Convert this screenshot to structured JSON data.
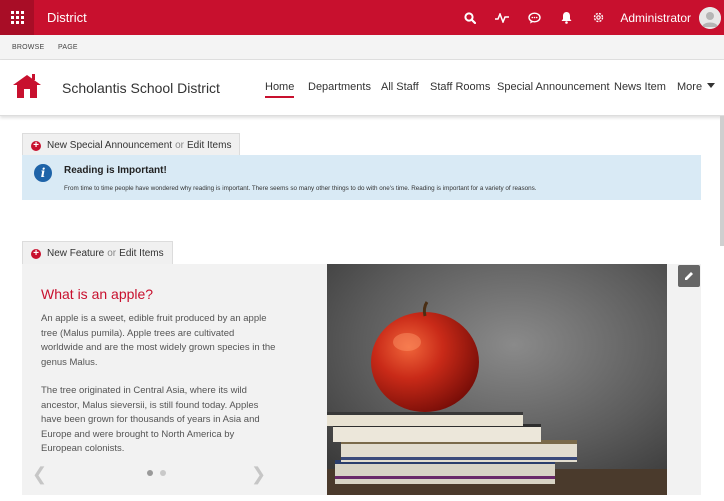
{
  "topbar": {
    "title": "District",
    "user": "Administrator"
  },
  "ribbon": {
    "browse": "BROWSE",
    "page": "PAGE"
  },
  "site": {
    "title": "Scholantis School District"
  },
  "nav": {
    "items": [
      "Home",
      "Departments",
      "All Staff",
      "Staff Rooms",
      "Special Announcement",
      "News Item"
    ],
    "more": "More"
  },
  "announcement_toolbar": {
    "new_label": "New Special Announcement",
    "or": "or",
    "edit_label": "Edit Items"
  },
  "announcement": {
    "title": "Reading is Important!",
    "body": "From time to time people have wondered why reading is important. There seems so many other things to do with one's time. Reading is important for a variety of reasons."
  },
  "feature_toolbar": {
    "new_label": "New Feature",
    "or": "or",
    "edit_label": "Edit Items"
  },
  "feature": {
    "title": "What is an apple?",
    "paragraph1": "An apple is a sweet, edible fruit produced by an apple tree (Malus pumila). Apple trees are cultivated worldwide and are the most widely grown species in the genus Malus.",
    "paragraph2": "The tree originated in Central Asia, where its wild ancestor, Malus sieversii, is still found today. Apples have been grown for thousands of years in Asia and Europe and were brought to North America by European colonists.",
    "slide_count": 2,
    "active_slide": 1
  },
  "colors": {
    "brand": "#c8102e",
    "info_bg": "#d9eaf5",
    "info_icon": "#1e63a8"
  },
  "icons": [
    "app-launcher-icon",
    "search-icon",
    "activity-icon",
    "chat-icon",
    "notification-bell-icon",
    "settings-gear-icon",
    "user-avatar-icon",
    "school-logo-icon",
    "info-icon",
    "add-circle-icon",
    "pencil-edit-icon",
    "chevron-left-icon",
    "chevron-right-icon"
  ]
}
